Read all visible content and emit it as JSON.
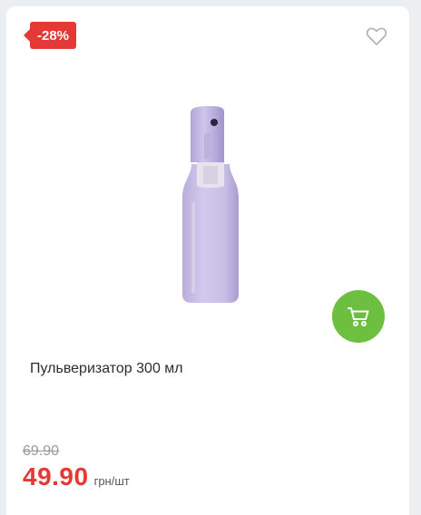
{
  "product": {
    "discount_badge": "-28%",
    "title": "Пульверизатор 300 мл",
    "old_price": "69.90",
    "current_price": "49.90",
    "unit": "грн/шт"
  },
  "icons": {
    "favorite": "heart-outline-icon",
    "cart": "cart-icon"
  },
  "colors": {
    "discount_red": "#e53935",
    "cart_green": "#6cbf3f",
    "product_lilac": "#c7bde3"
  }
}
